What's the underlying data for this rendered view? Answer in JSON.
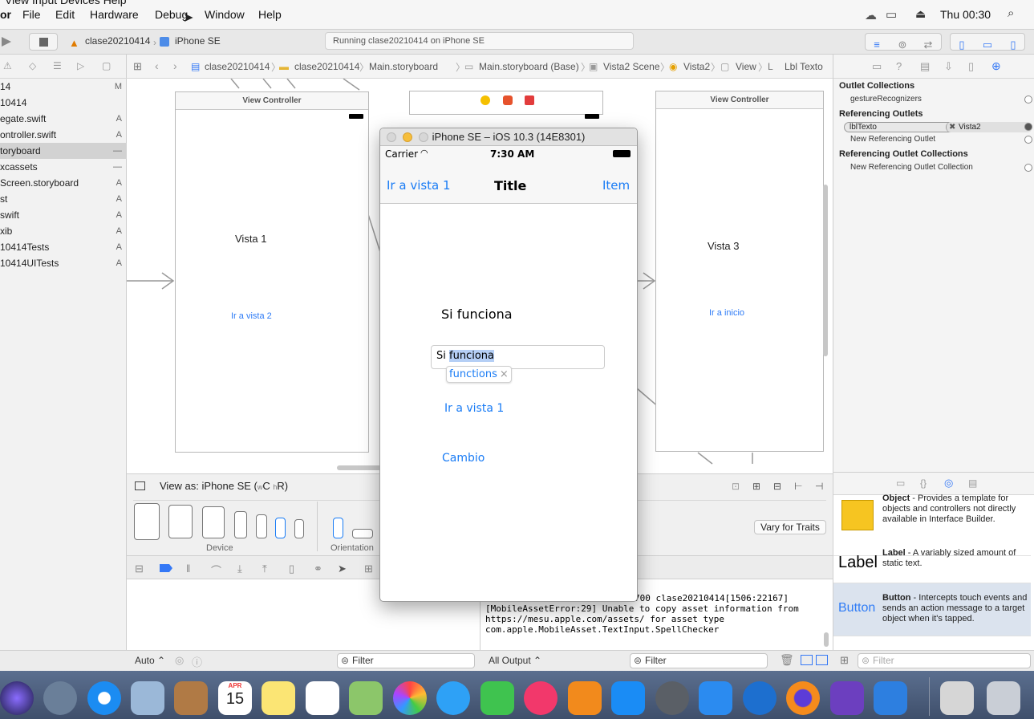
{
  "menubar": {
    "clipped_top": "View   Input   Devices   Help",
    "app_partial": "or",
    "items": [
      "File",
      "Edit",
      "Hardware",
      "Debug",
      "Window",
      "Help"
    ],
    "clock": "Thu 00:30"
  },
  "toolbar": {
    "scheme_name": "clase20210414",
    "device_name": "iPhone SE",
    "status": "Running clase20210414 on iPhone SE"
  },
  "jumpbar": {
    "crumbs": [
      "clase20210414",
      "clase20210414",
      "Main.storyboard",
      "Main.storyboard (Base)",
      "Vista2 Scene",
      "Vista2",
      "View",
      "Lbl Texto"
    ]
  },
  "navigator": {
    "rows": [
      {
        "name": "14",
        "status": "M"
      },
      {
        "name": "10414",
        "status": ""
      },
      {
        "name": "egate.swift",
        "status": "A"
      },
      {
        "name": "ontroller.swift",
        "status": "A"
      },
      {
        "name": "toryboard",
        "status": "—"
      },
      {
        "name": "xcassets",
        "status": "—"
      },
      {
        "name": "Screen.storyboard",
        "status": "A"
      },
      {
        "name": "st",
        "status": "A"
      },
      {
        "name": "swift",
        "status": "A"
      },
      {
        "name": "xib",
        "status": "A"
      },
      {
        "name": "10414Tests",
        "status": "A"
      },
      {
        "name": "10414UITests",
        "status": "A"
      }
    ]
  },
  "canvas": {
    "scene1": {
      "header": "View Controller",
      "label": "Vista 1",
      "link": "Ir a vista 2"
    },
    "scene3": {
      "header": "View Controller",
      "label": "Vista 3",
      "link": "Ir a inicio"
    }
  },
  "devicebar": {
    "view_as": "View as: iPhone SE (",
    "view_as_c": "C",
    "view_as_r": "R)",
    "w_letter": "w",
    "h_letter": "h",
    "device_label": "Device",
    "orientation_label": "Orientation",
    "vary_button": "Vary for Traits"
  },
  "console": {
    "partial_top": "700 clase20210414[1506:22167]",
    "lines": "[MobileAssetError:29] Unable to copy asset information from\nhttps://mesu.apple.com/assets/ for asset type\ncom.apple.MobileAsset.TextInput.SpellChecker"
  },
  "filterbar": {
    "auto": "Auto ⌃",
    "filter": "Filter",
    "all_output": "All Output ⌃",
    "filter2": "Filter",
    "filter3": "Filter"
  },
  "inspector": {
    "outlet_collections": "Outlet Collections",
    "gesture_recognizers": "gestureRecognizers",
    "referencing_outlets": "Referencing Outlets",
    "outlet_name": "lblTexto",
    "outlet_target": "Vista2",
    "new_referencing_outlet": "New Referencing Outlet",
    "referencing_outlet_collections": "Referencing Outlet Collections",
    "new_referencing_outlet_collection": "New Referencing Outlet Collection"
  },
  "library": {
    "items": [
      {
        "title": "Object",
        "desc": " - Provides a template for objects and controllers not directly available in Interface Builder."
      },
      {
        "title": "Label",
        "desc": " - A variably sized amount of static text.",
        "preview": "Label"
      },
      {
        "title": "Button",
        "desc": " - Intercepts touch events and sends an action message to a target object when it's tapped.",
        "preview": "Button"
      }
    ]
  },
  "simulator": {
    "title": "iPhone SE – iOS 10.3 (14E8301)",
    "carrier": "Carrier",
    "time": "7:30 AM",
    "nav_left": "Ir a vista 1",
    "nav_title": "Title",
    "nav_right": "Item",
    "label": "Si funciona",
    "field_prefix": "Si ",
    "field_selected": "funciona",
    "suggestion": "functions",
    "link1": "Ir a vista 1",
    "link2": "Cambio"
  },
  "dock": {
    "calendar_month": "APR",
    "calendar_day": "15"
  },
  "colors": {
    "accent": "#2f7cf6",
    "ios_blue": "#1a7cf5"
  }
}
